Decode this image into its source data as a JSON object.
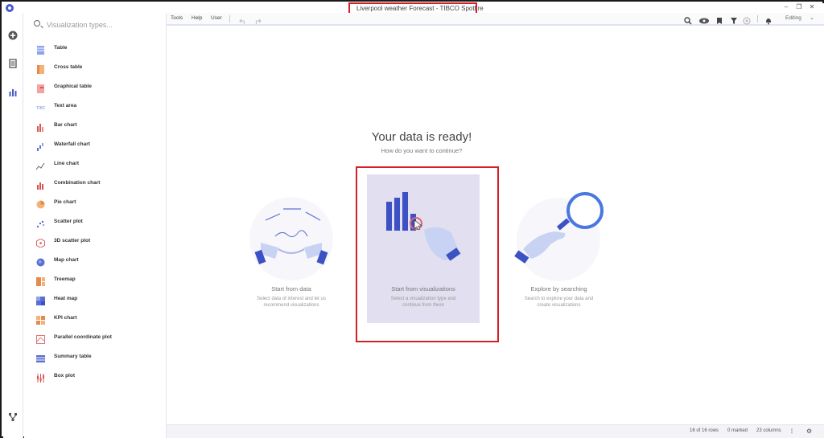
{
  "window": {
    "title": "Liverpool weather Forecast - TIBCO Spotfire",
    "controls": [
      "minimize-icon",
      "restore-icon",
      "close-icon"
    ]
  },
  "rail": {
    "icons": [
      "add-icon",
      "data-icon",
      "visualizations-icon",
      "data-canvas-icon"
    ]
  },
  "viz_panel": {
    "search_placeholder": "Visualization types...",
    "items": [
      {
        "label": "Table",
        "icon": "table-icon"
      },
      {
        "label": "Cross table",
        "icon": "cross-table-icon"
      },
      {
        "label": "Graphical table",
        "icon": "graphical-table-icon"
      },
      {
        "label": "Text area",
        "icon": "text-area-icon"
      },
      {
        "label": "Bar chart",
        "icon": "bar-chart-icon"
      },
      {
        "label": "Waterfall chart",
        "icon": "waterfall-chart-icon"
      },
      {
        "label": "Line chart",
        "icon": "line-chart-icon"
      },
      {
        "label": "Combination chart",
        "icon": "combination-chart-icon"
      },
      {
        "label": "Pie chart",
        "icon": "pie-chart-icon"
      },
      {
        "label": "Scatter plot",
        "icon": "scatter-plot-icon"
      },
      {
        "label": "3D scatter plot",
        "icon": "3d-scatter-plot-icon"
      },
      {
        "label": "Map chart",
        "icon": "map-chart-icon"
      },
      {
        "label": "Treemap",
        "icon": "treemap-icon"
      },
      {
        "label": "Heat map",
        "icon": "heat-map-icon"
      },
      {
        "label": "KPI chart",
        "icon": "kpi-chart-icon"
      },
      {
        "label": "Parallel coordinate plot",
        "icon": "parallel-coordinate-plot-icon"
      },
      {
        "label": "Summary table",
        "icon": "summary-table-icon"
      },
      {
        "label": "Box plot",
        "icon": "box-plot-icon"
      }
    ]
  },
  "toolbar": {
    "menus": [
      "Tools",
      "Help",
      "User"
    ],
    "icons": [
      "undo-icon",
      "redo-icon",
      "search-icon",
      "recommendations-icon",
      "bookmark-icon",
      "filter-icon",
      "collaboration-icon",
      "notifications-icon"
    ],
    "mode": "Editing"
  },
  "main": {
    "heading": "Your data is ready!",
    "subheading": "How do you want to continue?",
    "options": [
      {
        "title": "Start from data",
        "desc_line1": "Select data of interest and let us",
        "desc_line2": "recommend visualizations"
      },
      {
        "title": "Start from visualizations",
        "desc_line1": "Select a visualization type and",
        "desc_line2": "continue from there"
      },
      {
        "title": "Explore by searching",
        "desc_line1": "Search to explore your data and",
        "desc_line2": "create visualizations"
      }
    ]
  },
  "statusbar": {
    "rows": "16 of 16 rows",
    "marked": "0 marked",
    "columns": "23 columns"
  },
  "colors": {
    "accent": "#4a58c8",
    "highlight_box": "#d42127",
    "card_selected": "#e2dff0"
  }
}
